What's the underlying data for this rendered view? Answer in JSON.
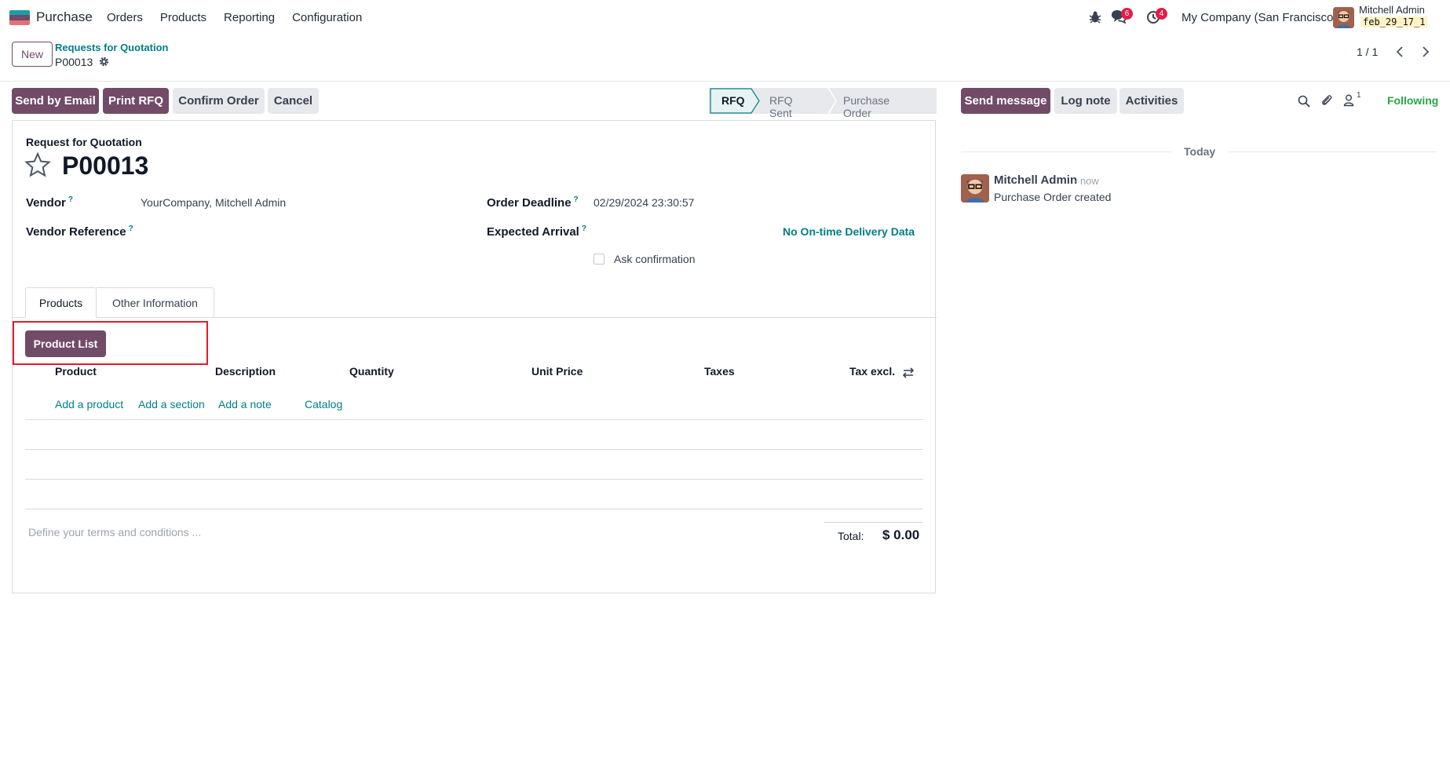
{
  "navbar": {
    "app_name": "Purchase",
    "menu": [
      "Orders",
      "Products",
      "Reporting",
      "Configuration"
    ],
    "messages_count": "6",
    "activities_count": "4",
    "company": "My Company (San Francisco)",
    "user_name": "Mitchell Admin",
    "database": "feb_29_17_1"
  },
  "control": {
    "new_label": "New",
    "breadcrumb": "Requests for Quotation",
    "record": "P00013",
    "pager": "1 / 1"
  },
  "actions": {
    "send_email": "Send by Email",
    "print_rfq": "Print RFQ",
    "confirm": "Confirm Order",
    "cancel": "Cancel"
  },
  "statusbar": [
    "RFQ",
    "RFQ Sent",
    "Purchase Order"
  ],
  "form": {
    "doc_label": "Request for Quotation",
    "doc_name": "P00013",
    "vendor_label": "Vendor",
    "vendor_value": "YourCompany, Mitchell Admin",
    "vendor_ref_label": "Vendor Reference",
    "deadline_label": "Order Deadline",
    "deadline_value": "02/29/2024 23:30:57",
    "arrival_label": "Expected Arrival",
    "ontime": "No On-time Delivery Data",
    "ask_confirmation": "Ask confirmation",
    "help_mark": "?"
  },
  "tabs": [
    "Products",
    "Other Information"
  ],
  "product_list_btn": "Product List",
  "table": {
    "headers": [
      "Product",
      "Description",
      "Quantity",
      "Unit Price",
      "Taxes",
      "Tax excl."
    ],
    "add_links": [
      "Add a product",
      "Add a section",
      "Add a note",
      "Catalog"
    ]
  },
  "footer": {
    "terms_placeholder": "Define your terms and conditions ...",
    "total_label": "Total:",
    "total_value": "$ 0.00"
  },
  "chatter": {
    "send_message": "Send message",
    "log_note": "Log note",
    "activities": "Activities",
    "followers_count": "1",
    "following": "Following",
    "date_separator": "Today",
    "author": "Mitchell Admin",
    "time": "- now",
    "body": "Purchase Order created"
  },
  "colors": {
    "primary": "#714b67",
    "teal": "#017e84",
    "success": "#28a745",
    "badge": "#e11d48"
  }
}
